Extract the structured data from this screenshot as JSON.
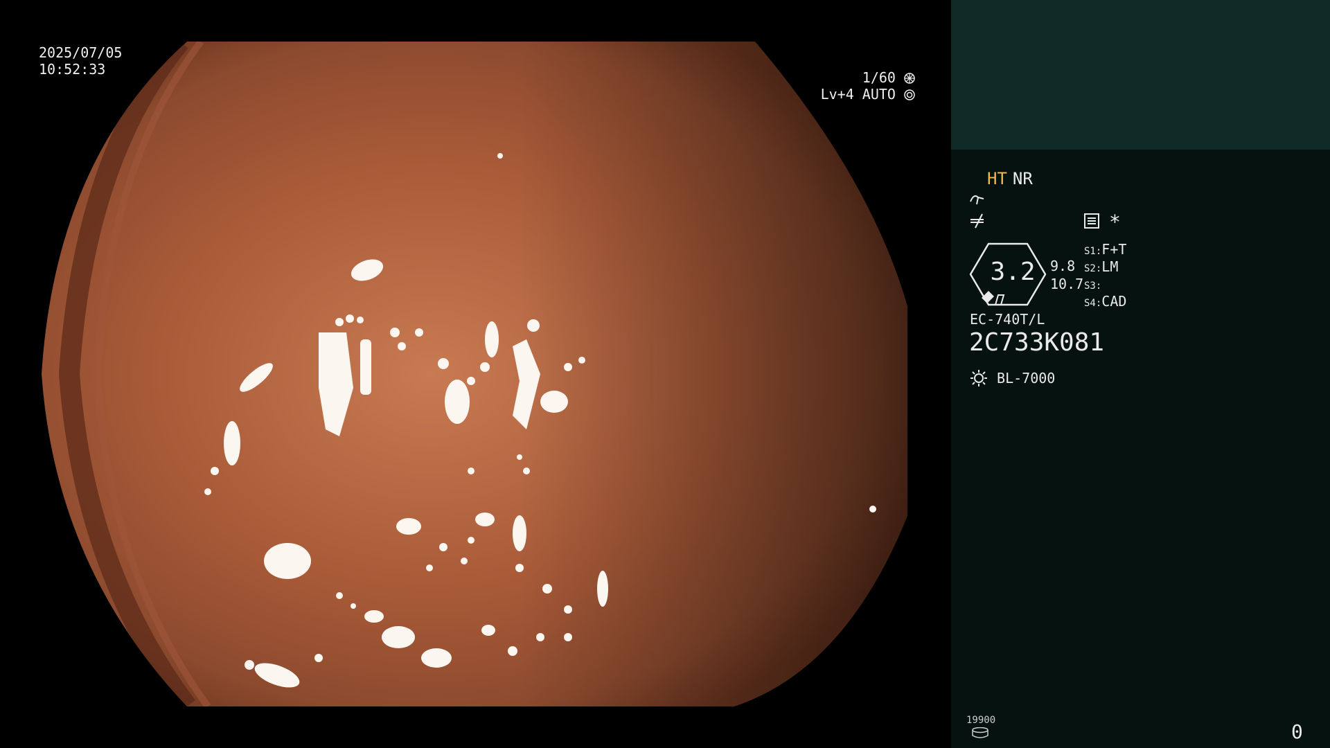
{
  "overlay": {
    "date": "2025/07/05",
    "time": "10:52:33",
    "shutter": "1/60",
    "iris": "Lv+4 AUTO"
  },
  "panel": {
    "mode_ht": "HT",
    "mode_nr": "NR",
    "star": "*",
    "zoom_value": "3.2",
    "zoom_sub1": "9.8",
    "zoom_sub2": "10.7",
    "switches": [
      {
        "key": "S1:",
        "value": "F+T"
      },
      {
        "key": "S2:",
        "value": "LM"
      },
      {
        "key": "S3:",
        "value": ""
      },
      {
        "key": "S4:",
        "value": "CAD"
      }
    ],
    "scope_model": "EC-740T/L",
    "scope_serial": "2C733K081",
    "light_source": "BL-7000",
    "accent_color": "#f2b84a"
  },
  "footer": {
    "record_count": "19900",
    "counter": "0"
  },
  "icons": [
    "aperture-icon",
    "auto-iris-icon",
    "enhancement-curve-icon",
    "color-tone-icon",
    "settings-list-icon",
    "scope-tip-icon",
    "light-source-icon",
    "storage-disk-icon"
  ]
}
